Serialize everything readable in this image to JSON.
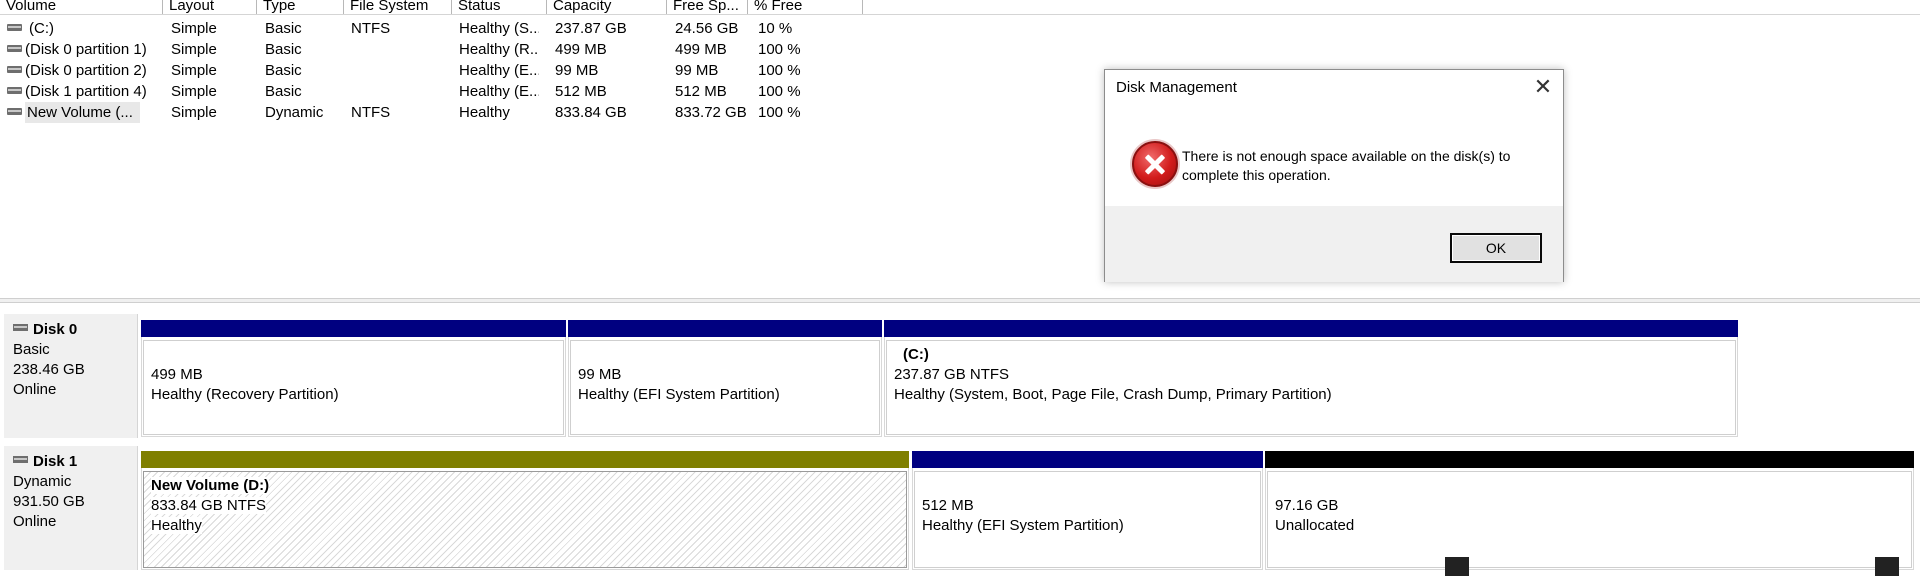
{
  "columns": {
    "volume": "Volume",
    "layout": "Layout",
    "type": "Type",
    "file_system": "File System",
    "status": "Status",
    "capacity": "Capacity",
    "free_space": "Free Sp...",
    "pct_free": "% Free"
  },
  "volumes": [
    {
      "name": "(C:)",
      "layout": "Simple",
      "type": "Basic",
      "fs": "NTFS",
      "status": "Healthy (S...",
      "capacity": "237.87 GB",
      "free": "24.56 GB",
      "pct": "10 %"
    },
    {
      "name": "(Disk 0 partition 1)",
      "layout": "Simple",
      "type": "Basic",
      "fs": "",
      "status": "Healthy (R...",
      "capacity": "499 MB",
      "free": "499 MB",
      "pct": "100 %"
    },
    {
      "name": "(Disk 0 partition 2)",
      "layout": "Simple",
      "type": "Basic",
      "fs": "",
      "status": "Healthy (E...",
      "capacity": "99 MB",
      "free": "99 MB",
      "pct": "100 %"
    },
    {
      "name": "(Disk 1 partition 4)",
      "layout": "Simple",
      "type": "Basic",
      "fs": "",
      "status": "Healthy (E...",
      "capacity": "512 MB",
      "free": "512 MB",
      "pct": "100 %"
    },
    {
      "name": "New Volume (...",
      "layout": "Simple",
      "type": "Dynamic",
      "fs": "NTFS",
      "status": "Healthy",
      "capacity": "833.84 GB",
      "free": "833.72 GB",
      "pct": "100 %"
    }
  ],
  "disks": [
    {
      "name": "Disk 0",
      "kind": "Basic",
      "size": "238.46 GB",
      "state": "Online",
      "partitions": [
        {
          "title": "",
          "size": "499 MB",
          "status": "Healthy (Recovery Partition)"
        },
        {
          "title": "",
          "size": "99 MB",
          "status": "Healthy (EFI System Partition)"
        },
        {
          "title": "(C:)",
          "size": "237.87 GB NTFS",
          "status": "Healthy (System, Boot, Page File, Crash Dump, Primary Partition)"
        }
      ]
    },
    {
      "name": "Disk 1",
      "kind": "Dynamic",
      "size": "931.50 GB",
      "state": "Online",
      "partitions": [
        {
          "title": "New Volume  (D:)",
          "size": "833.84 GB NTFS",
          "status": "Healthy"
        },
        {
          "title": "",
          "size": "512 MB",
          "status": "Healthy (EFI System Partition)"
        },
        {
          "title": "",
          "size": "97.16 GB",
          "status": "Unallocated"
        }
      ]
    }
  ],
  "dialog": {
    "title": "Disk Management",
    "close": "✕",
    "message": "There is not enough space available on the disk(s) to complete this operation.",
    "ok": "OK",
    "icon": "error-icon"
  },
  "colors": {
    "primary_partition": "#000080",
    "simple_volume": "#7f7f00",
    "unallocated": "#000000"
  }
}
